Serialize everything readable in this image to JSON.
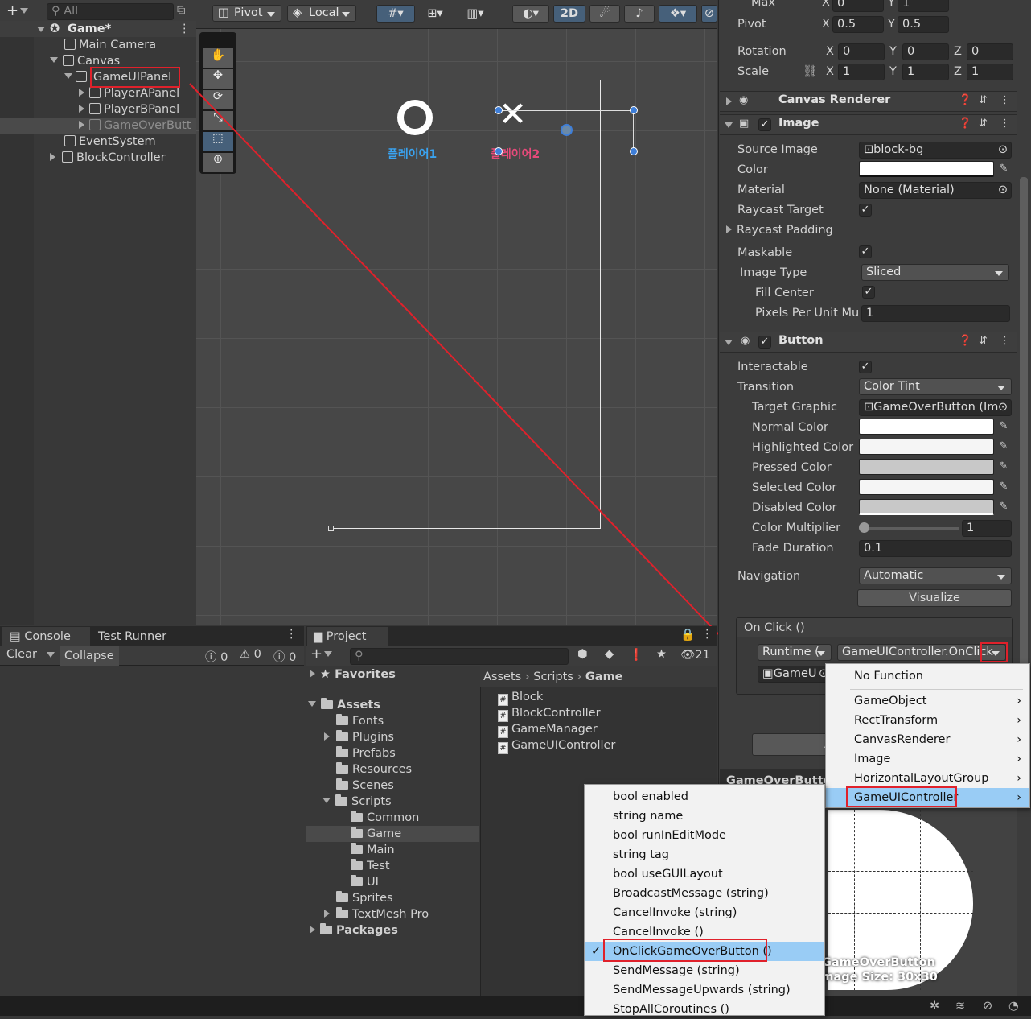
{
  "hierarchy": {
    "search_placeholder": "All",
    "scene": "Game*",
    "items": [
      "Main Camera",
      "Canvas",
      "GameUIPanel",
      "PlayerAPanel",
      "PlayerBPanel",
      "GameOverButt",
      "EventSystem",
      "BlockController"
    ]
  },
  "scene_toolbar": {
    "pivot": "Pivot",
    "local": "Local",
    "mode_2d": "2D"
  },
  "scene_view": {
    "player1": "플레이어1",
    "player2": "플레이어2",
    "o_mark": "O",
    "x_mark": "✕"
  },
  "console": {
    "tab": "Console",
    "tab2": "Test Runner",
    "clear": "Clear",
    "collapse": "Collapse",
    "info": "0",
    "warn": "0",
    "error": "0"
  },
  "project": {
    "tab": "Project",
    "count": "21",
    "favorites": "Favorites",
    "assets": "Assets",
    "folders": [
      "Fonts",
      "Plugins",
      "Prefabs",
      "Resources",
      "Scenes",
      "Scripts",
      "Common",
      "Game",
      "Main",
      "Test",
      "UI",
      "Sprites",
      "TextMesh Pro"
    ],
    "packages": "Packages",
    "breadcrumb": [
      "Assets",
      "Scripts",
      "Game"
    ],
    "files": [
      "Block",
      "BlockController",
      "GameManager",
      "GameUIController"
    ]
  },
  "inspector": {
    "max_label": "Max",
    "max_x": "0",
    "max_y": "1",
    "pivot_label": "Pivot",
    "pivot_x": "0.5",
    "pivot_y": "0.5",
    "rotation_label": "Rotation",
    "rot_x": "0",
    "rot_y": "0",
    "rot_z": "0",
    "scale_label": "Scale",
    "scale_x": "1",
    "scale_y": "1",
    "scale_z": "1",
    "canvas_renderer": "Canvas Renderer",
    "image": {
      "title": "Image",
      "source_image_label": "Source Image",
      "source_image": "block-bg",
      "color_label": "Color",
      "material_label": "Material",
      "material": "None (Material)",
      "raycast_target": "Raycast Target",
      "raycast_padding": "Raycast Padding",
      "maskable": "Maskable",
      "image_type_label": "Image Type",
      "image_type": "Sliced",
      "fill_center": "Fill Center",
      "ppu_label": "Pixels Per Unit Mu",
      "ppu": "1"
    },
    "button": {
      "title": "Button",
      "interactable": "Interactable",
      "transition_label": "Transition",
      "transition": "Color Tint",
      "target_graphic_label": "Target Graphic",
      "target_graphic": "GameOverButton (Im",
      "normal": "Normal Color",
      "highlighted": "Highlighted Color",
      "pressed": "Pressed Color",
      "selected": "Selected Color",
      "disabled": "Disabled Color",
      "multiplier_label": "Color Multiplier",
      "multiplier": "1",
      "fade_label": "Fade Duration",
      "fade": "0.1",
      "navigation_label": "Navigation",
      "navigation": "Automatic",
      "visualize": "Visualize"
    },
    "onclick": {
      "title": "On Click ()",
      "runtime": "Runtime (",
      "function": "GameUIController.OnClick",
      "object": "GameU"
    },
    "preview_name": "GameOverButton",
    "preview_footer": "GameOverButton",
    "preview_size": "Image Size: 30x30"
  },
  "menu1": {
    "items": [
      "No Function",
      "GameObject",
      "RectTransform",
      "CanvasRenderer",
      "Image",
      "HorizontalLayoutGroup",
      "GameUIController"
    ]
  },
  "menu2": {
    "items": [
      "bool enabled",
      "string name",
      "bool runInEditMode",
      "string tag",
      "bool useGUILayout",
      "BroadcastMessage (string)",
      "CancelInvoke (string)",
      "CancelInvoke ()",
      "OnClickGameOverButton ()",
      "SendMessage (string)",
      "SendMessageUpwards (string)",
      "StopAllCoroutines ()"
    ],
    "selected": "OnClickGameOverButton ()"
  },
  "colors": {
    "accent": "#2c5d87",
    "selection": "#99ccf5",
    "annotation": "#e0212b"
  }
}
